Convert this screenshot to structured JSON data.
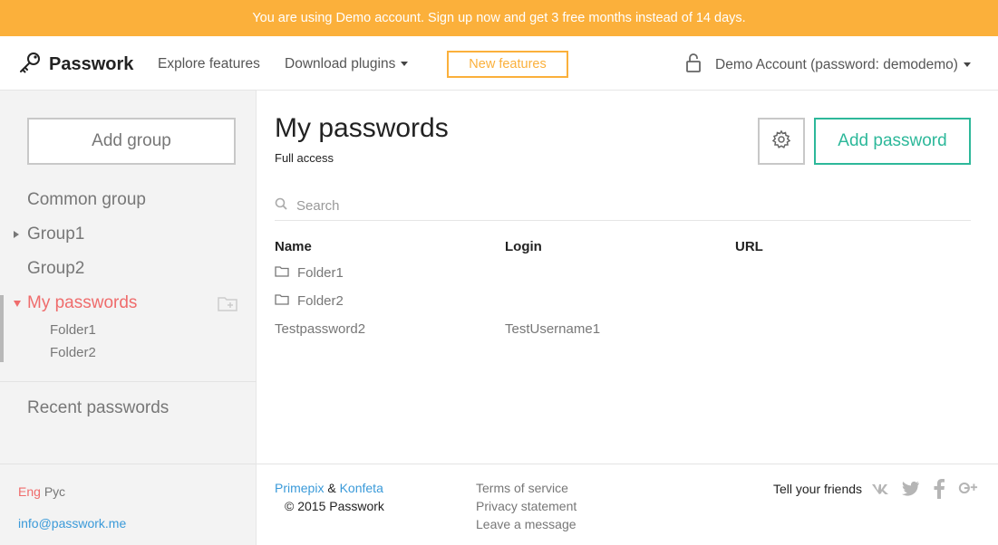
{
  "banner": {
    "text": "You are using Demo account. Sign up now and get 3 free months instead of 14 days."
  },
  "header": {
    "logo_text": "Passwork",
    "explore_label": "Explore features",
    "download_label": "Download plugins",
    "new_features_label": "New features",
    "account_label": "Demo Account (password: demodemo)"
  },
  "sidebar": {
    "add_group_label": "Add group",
    "groups": [
      {
        "label": "Common group"
      },
      {
        "label": "Group1"
      },
      {
        "label": "Group2"
      },
      {
        "label": "My passwords"
      }
    ],
    "subfolders": [
      {
        "label": "Folder1"
      },
      {
        "label": "Folder2"
      }
    ],
    "recent_label": "Recent passwords"
  },
  "main": {
    "title": "My passwords",
    "subtitle": "Full access",
    "add_password_label": "Add password",
    "search_placeholder": "Search",
    "columns": {
      "name": "Name",
      "login": "Login",
      "url": "URL"
    },
    "rows": [
      {
        "name": "Folder1",
        "login": "",
        "url": ""
      },
      {
        "name": "Folder2",
        "login": "",
        "url": ""
      },
      {
        "name": "Testpassword2",
        "login": "TestUsername1",
        "url": ""
      }
    ]
  },
  "footer": {
    "lang_eng": "Eng",
    "lang_rus": "Рус",
    "email": "info@passwork.me",
    "primepix": "Primepix",
    "amp": "&",
    "konfeta": "Konfeta",
    "copyright": "© 2015 Passwork",
    "terms": "Terms of service",
    "privacy": "Privacy statement",
    "message": "Leave a message",
    "tell_friends": "Tell your friends"
  },
  "colors": {
    "banner": "#fbb03b",
    "accent_green": "#2db89a",
    "active_red": "#ef6c6c",
    "link_blue": "#3a9ad9"
  }
}
